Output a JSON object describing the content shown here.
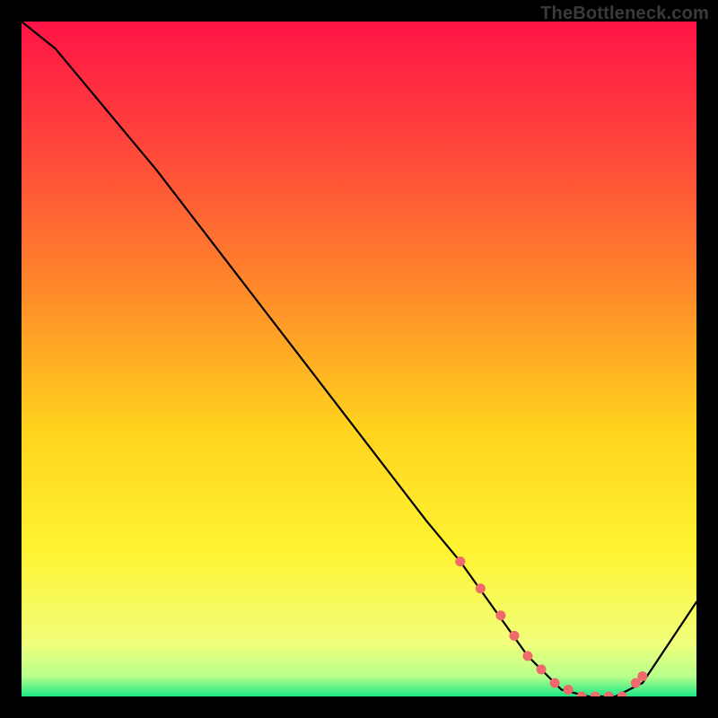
{
  "watermark": "TheBottleneck.com",
  "chart_data": {
    "type": "line",
    "title": "",
    "xlabel": "",
    "ylabel": "",
    "xlim": [
      0,
      100
    ],
    "ylim": [
      0,
      100
    ],
    "series": [
      {
        "name": "curve",
        "x": [
          0,
          5,
          10,
          20,
          30,
          40,
          50,
          60,
          65,
          70,
          75,
          80,
          84,
          88,
          92,
          100
        ],
        "y": [
          100,
          96,
          90,
          78,
          65,
          52,
          39,
          26,
          20,
          13,
          6,
          1,
          0,
          0,
          2,
          14
        ]
      },
      {
        "name": "markers",
        "x": [
          65,
          68,
          71,
          73,
          75,
          77,
          79,
          81,
          83,
          85,
          87,
          89,
          91,
          92
        ],
        "y": [
          20,
          16,
          12,
          9,
          6,
          4,
          2,
          1,
          0,
          0,
          0,
          0,
          2,
          3
        ]
      }
    ],
    "gradient_stops": [
      {
        "offset": 0.0,
        "color": "#ff1446"
      },
      {
        "offset": 0.2,
        "color": "#ff4a3a"
      },
      {
        "offset": 0.4,
        "color": "#ff8a2a"
      },
      {
        "offset": 0.6,
        "color": "#ffd21e"
      },
      {
        "offset": 0.78,
        "color": "#fff330"
      },
      {
        "offset": 0.92,
        "color": "#f2ff7a"
      },
      {
        "offset": 0.97,
        "color": "#b9ff8c"
      },
      {
        "offset": 1.0,
        "color": "#1de886"
      }
    ],
    "marker_color": "#ef6a6a",
    "line_color": "#000000"
  }
}
